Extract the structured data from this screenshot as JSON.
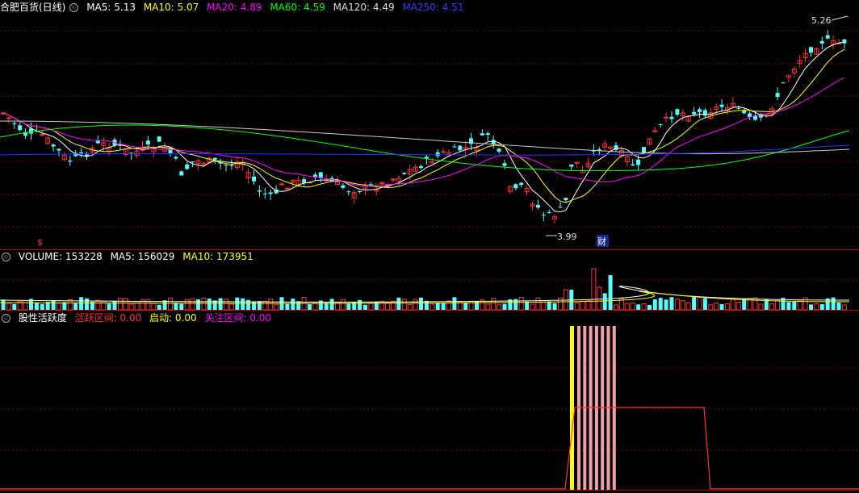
{
  "colors": {
    "up": "#ff3232",
    "down": "#54ffff",
    "ma5": "#ffffff",
    "ma10": "#ffff00",
    "ma20": "#ff00ff",
    "ma60": "#00ff00",
    "ma120": "#cccccc",
    "ma250": "#3030ff",
    "grid": "#7a0000",
    "border": "#b00000",
    "pink": "#f0a0a8",
    "yellow": "#ffff00",
    "redline": "#ff3232"
  },
  "price_header": {
    "title": "合肥百货(日线)",
    "ma5": "MA5: 5.13",
    "ma10": "MA10: 5.07",
    "ma20": "MA20: 4.89",
    "ma60": "MA60: 4.59",
    "ma120": "MA120: 4.49",
    "ma250": "MA250: 4.51"
  },
  "volume_header": {
    "title": "VOLUME: 153228",
    "ma5": "MA5: 156029",
    "ma10": "MA10: 173951"
  },
  "indicator_header": {
    "title": "股性活跃度",
    "active": "活跃区间: 0.00",
    "start": "启动: 0.00",
    "focus": "关注区间: 0.00"
  },
  "price_labels": {
    "high": "5.26",
    "low": "3.99",
    "fin_marker": "财",
    "dollar_marker": "$"
  },
  "chart_data": [
    {
      "type": "candlestick",
      "panel": "price",
      "title": "合肥百货(日线)",
      "series": [
        "MA5",
        "MA10",
        "MA20",
        "MA60",
        "MA120",
        "MA250"
      ],
      "last_values": {
        "MA5": 5.13,
        "MA10": 5.07,
        "MA20": 4.89,
        "MA60": 4.59,
        "MA120": 4.49,
        "MA250": 4.51
      },
      "high": 5.26,
      "low": 3.99
    },
    {
      "type": "bar",
      "panel": "volume",
      "last_values": {
        "VOLUME": 153228,
        "MA5": 156029,
        "MA10": 173951
      }
    },
    {
      "type": "bar",
      "panel": "indicator",
      "last_values": {
        "活跃区间": 0.0,
        "启动": 0.0,
        "关注区间": 0.0
      }
    }
  ]
}
